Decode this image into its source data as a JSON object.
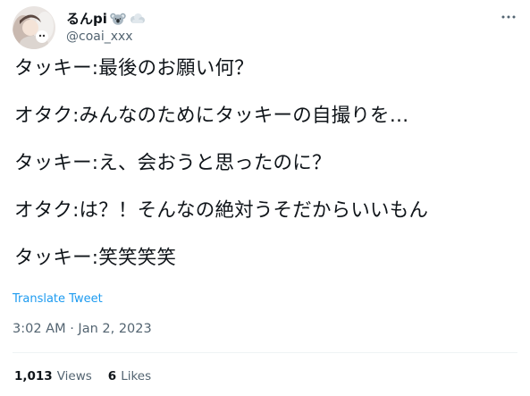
{
  "author": {
    "display_name": "るんpi",
    "handle": "@coai_xxx",
    "name_emojis": [
      "koala-emoji",
      "cloud-emoji"
    ]
  },
  "tweet": {
    "lines": [
      "タッキー:最後のお願い何？",
      "オタク:みんなのためにタッキーの自撮りを…",
      "タッキー:え、会おうと思ったのに？",
      "オタク:は？！そんなの絶対うそだからいいもん",
      "タッキー:笑笑笑笑"
    ],
    "translate_label": "Translate Tweet",
    "timestamp": "3:02 AM · Jan 2, 2023"
  },
  "stats": {
    "views_count": "1,013",
    "views_label": "Views",
    "likes_count": "6",
    "likes_label": "Likes"
  },
  "colors": {
    "link": "#1d9bf0",
    "secondary_text": "#536471",
    "primary_text": "#0f1419",
    "divider": "#eff3f4"
  },
  "icons": [
    "more-options-icon"
  ]
}
